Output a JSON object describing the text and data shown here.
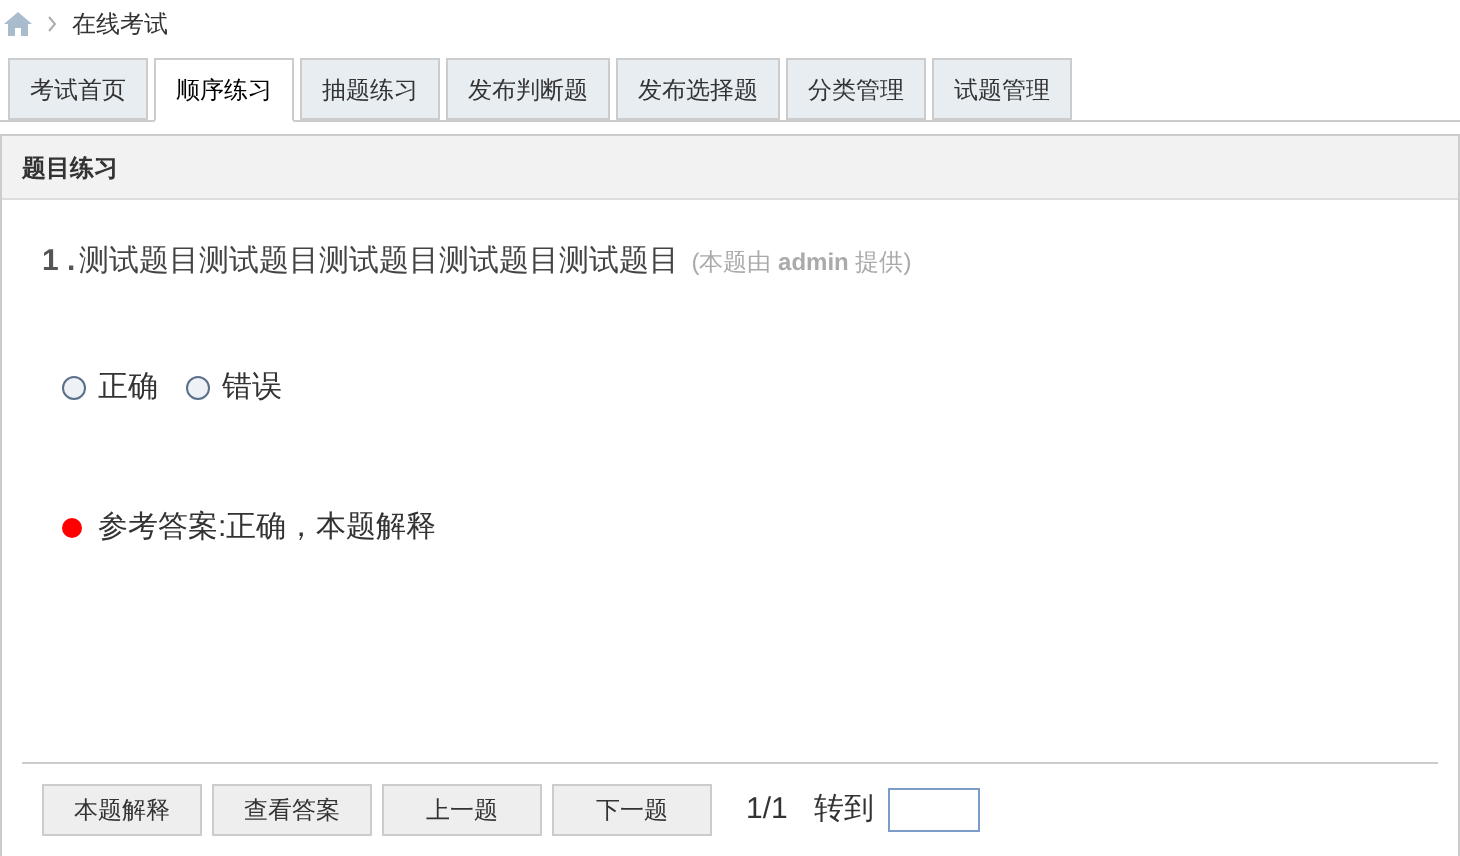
{
  "breadcrumb": {
    "current": "在线考试"
  },
  "tabs": [
    {
      "label": "考试首页",
      "selected": false
    },
    {
      "label": "顺序练习",
      "selected": true
    },
    {
      "label": "抽题练习",
      "selected": false
    },
    {
      "label": "发布判断题",
      "selected": false
    },
    {
      "label": "发布选择题",
      "selected": false
    },
    {
      "label": "分类管理",
      "selected": false
    },
    {
      "label": "试题管理",
      "selected": false
    }
  ],
  "panel": {
    "title": "题目练习"
  },
  "question": {
    "number": "1 .",
    "text": "测试题目测试题目测试题目测试题目测试题目",
    "note": "(本题由 **admin** 提供)"
  },
  "options": [
    {
      "label": "正确",
      "selected": false
    },
    {
      "label": "错误",
      "selected": false
    }
  ],
  "answer": "参考答案:正确，本题解释",
  "buttons": [
    "本题解释",
    "查看答案",
    "上一题",
    "下一题"
  ],
  "pager": {
    "position": "1/1",
    "goto_label": "转到"
  }
}
